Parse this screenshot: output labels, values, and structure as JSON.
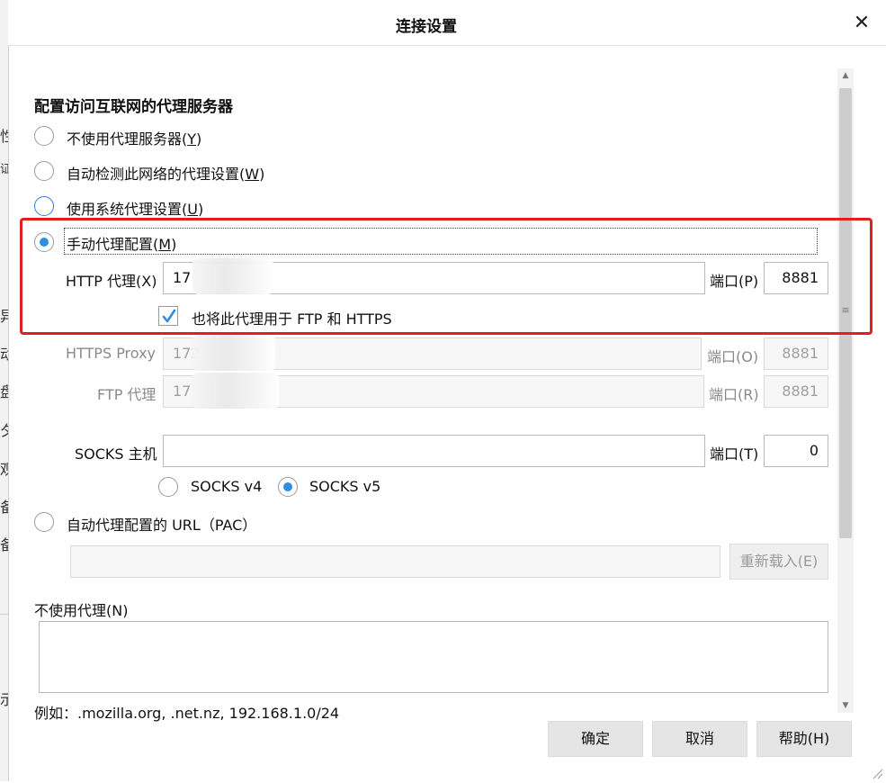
{
  "dialog": {
    "title": "连接设置",
    "close_glyph": "✕"
  },
  "background_fragments": [
    "性",
    "证",
    "异",
    "动",
    "盘",
    "夕",
    "观",
    "备",
    "备",
    "示"
  ],
  "section_heading": "配置访问互联网的代理服务器",
  "proxy_options": [
    {
      "text": "不使用代理服务器(",
      "key": "Y",
      "tail": ")",
      "selected": false
    },
    {
      "text": "自动检测此网络的代理设置(",
      "key": "W",
      "tail": ")",
      "selected": false
    },
    {
      "text": "使用系统代理设置(",
      "key": "U",
      "tail": ")",
      "selected": false
    },
    {
      "text": "手动代理配置(",
      "key": "M",
      "tail": ")",
      "selected": true
    }
  ],
  "http": {
    "label": "HTTP 代理(X)",
    "value": "17",
    "port_label": "端口(P)",
    "port": "8881"
  },
  "also_use": {
    "label": "也将此代理用于 FTP 和 HTTPS",
    "checked": true
  },
  "https": {
    "label": "HTTPS Proxy",
    "value": "172",
    "port_label": "端口(O)",
    "port": "8881"
  },
  "ftp": {
    "label": "FTP 代理",
    "value": "17",
    "port_label": "端口(R)",
    "port": "8881"
  },
  "socks": {
    "label": "SOCKS 主机",
    "value": "",
    "port_label": "端口(T)",
    "port": "0",
    "v4_label": "SOCKS v4",
    "v5_label": "SOCKS v5",
    "selected_version": "v5"
  },
  "pac": {
    "label": "自动代理配置的 URL（PAC）",
    "value": "",
    "reload_label": "重新载入(E)"
  },
  "no_proxy": {
    "label": "不使用代理(N)",
    "value": "",
    "example": "例如：.mozilla.org, .net.nz, 192.168.1.0/24"
  },
  "buttons": {
    "ok": "确定",
    "cancel": "取消",
    "help": "帮助(H)"
  },
  "colors": {
    "accent": "#2f8ee0",
    "highlight_box": "#e02020"
  }
}
